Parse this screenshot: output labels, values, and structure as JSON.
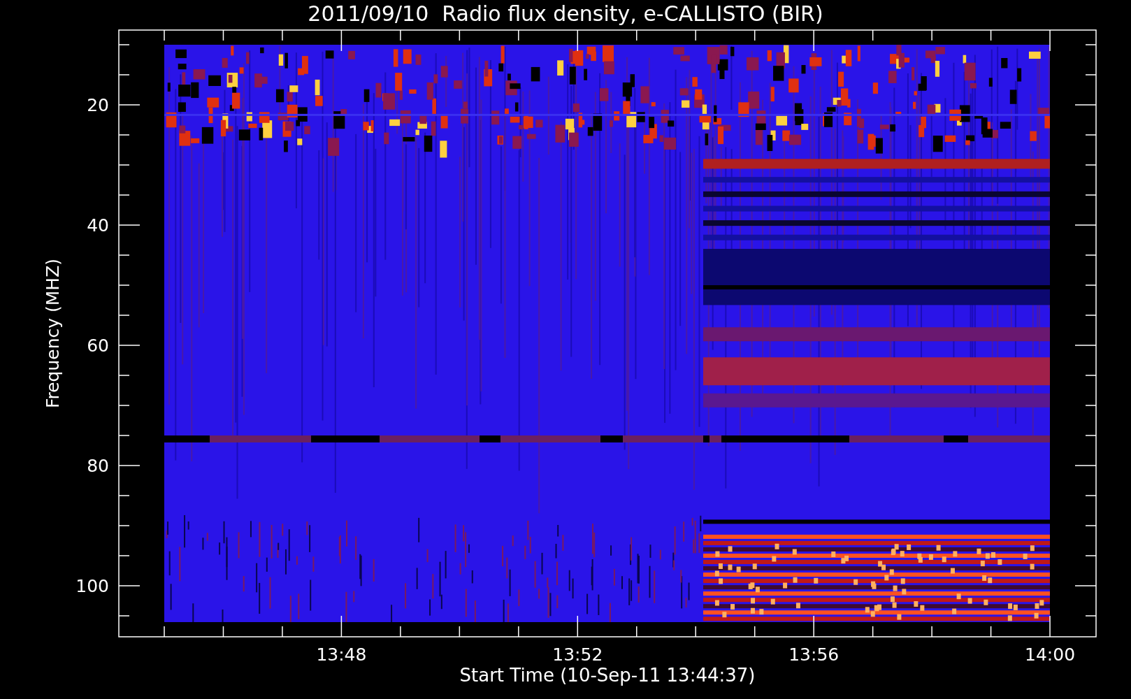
{
  "title": "2011/09/10  Radio flux density, e-CALLISTO (BIR)",
  "plot": {
    "y_axis": {
      "label": "Frequency (MHZ)",
      "ticks": [
        "20",
        "40",
        "60",
        "80",
        "100"
      ]
    },
    "x_axis": {
      "label": "Start Time (10-Sep-11 13:44:37)",
      "ticks": [
        "13:48",
        "13:52",
        "13:56",
        "14:00"
      ]
    }
  }
}
